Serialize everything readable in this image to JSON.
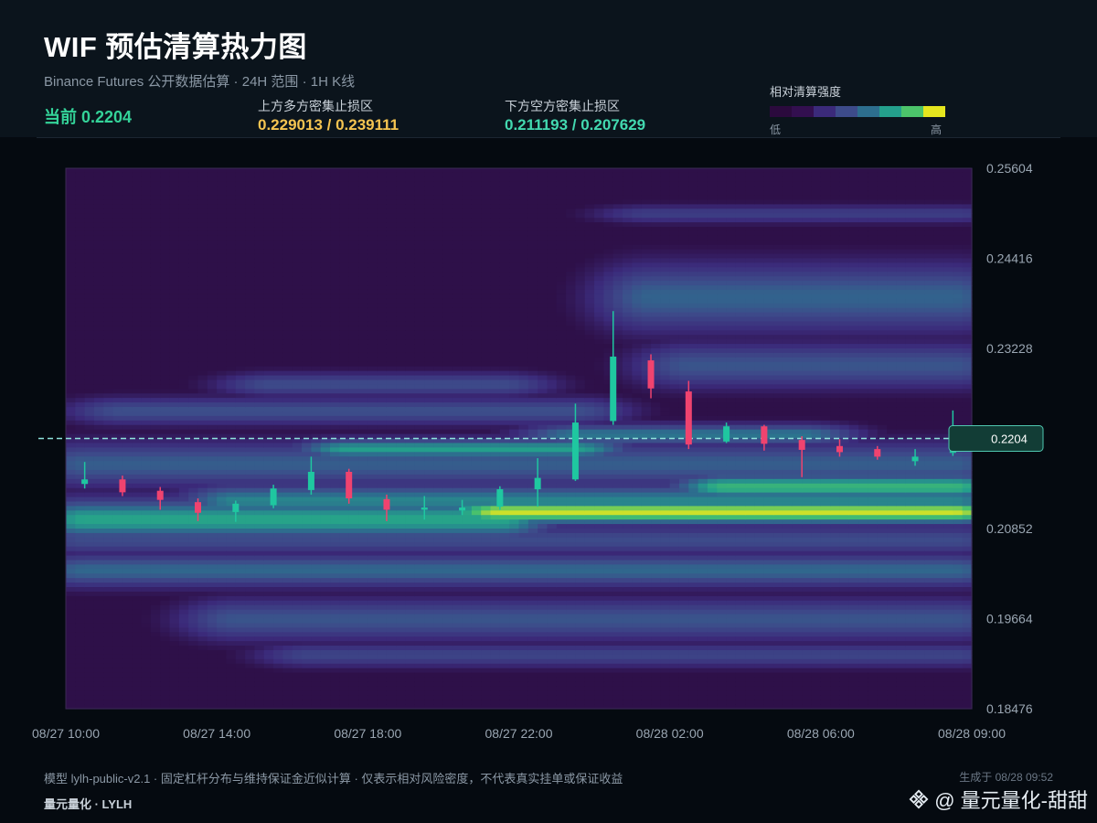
{
  "header": {
    "title": "WIF 预估清算热力图",
    "subtitle": "Binance Futures 公开数据估算 · 24H 范围 · 1H K线",
    "current_label": "当前 0.2204",
    "upper_zone_label": "上方多方密集止损区",
    "upper_zone_value": "0.229013 / 0.239111",
    "lower_zone_label": "下方空方密集止损区",
    "lower_zone_value": "0.211193 / 0.207629"
  },
  "legend": {
    "title": "相对清算强度",
    "low": "低",
    "high": "高",
    "colors": [
      "#2b0a3d",
      "#330f4f",
      "#3b2a7a",
      "#3d4b8a",
      "#2d6e8e",
      "#24a08c",
      "#4cc46a",
      "#e6e61e"
    ]
  },
  "footer": {
    "note": "模型 lylh-public-v2.1 · 固定杠杆分布与维持保证金近似计算 · 仅表示相对风险密度，不代表真实挂单或保证收益",
    "brand": "量元量化 · LYLH",
    "generated": "生成于 08/28 09:52",
    "watermark": "@ 量元量化-甜甜"
  },
  "chart_data": {
    "type": "heatmap",
    "title": "",
    "xlabel": "",
    "ylabel": "",
    "ylim": [
      0.18476,
      0.25604
    ],
    "y_ticks": [
      "0.25604",
      "0.24416",
      "0.23228",
      "0.20852",
      "0.19664",
      "0.18476"
    ],
    "x_ticks": [
      "08/27 10:00",
      "08/27 14:00",
      "08/27 18:00",
      "08/27 22:00",
      "08/28 02:00",
      "08/28 06:00",
      "08/28 09:00"
    ],
    "x_tick_hours": [
      0,
      4,
      8,
      12,
      16,
      20,
      23
    ],
    "current_price": 0.2204,
    "current_price_label": "0.2204",
    "colors": {
      "up": "#1fc7a0",
      "down": "#f0436f",
      "current_line": "#8fe3dc",
      "current_box": "#123d36"
    },
    "candles": [
      {
        "t": "08/27 10:00",
        "open": 0.2144,
        "high": 0.2173,
        "low": 0.2138,
        "close": 0.215
      },
      {
        "t": "08/27 11:00",
        "open": 0.215,
        "high": 0.2155,
        "low": 0.2128,
        "close": 0.2133
      },
      {
        "t": "08/27 12:00",
        "open": 0.2135,
        "high": 0.214,
        "low": 0.211,
        "close": 0.2123
      },
      {
        "t": "08/27 13:00",
        "open": 0.212,
        "high": 0.2125,
        "low": 0.2095,
        "close": 0.2106
      },
      {
        "t": "08/27 14:00",
        "open": 0.2107,
        "high": 0.2122,
        "low": 0.2094,
        "close": 0.2118
      },
      {
        "t": "08/27 15:00",
        "open": 0.2116,
        "high": 0.2143,
        "low": 0.2112,
        "close": 0.2138
      },
      {
        "t": "08/27 16:00",
        "open": 0.2136,
        "high": 0.218,
        "low": 0.213,
        "close": 0.216
      },
      {
        "t": "08/27 17:00",
        "open": 0.216,
        "high": 0.2164,
        "low": 0.2118,
        "close": 0.2125
      },
      {
        "t": "08/27 18:00",
        "open": 0.2124,
        "high": 0.213,
        "low": 0.2095,
        "close": 0.211
      },
      {
        "t": "08/27 19:00",
        "open": 0.211,
        "high": 0.2128,
        "low": 0.2097,
        "close": 0.2113
      },
      {
        "t": "08/27 20:00",
        "open": 0.2109,
        "high": 0.2123,
        "low": 0.2103,
        "close": 0.2113
      },
      {
        "t": "08/27 21:00",
        "open": 0.2114,
        "high": 0.2141,
        "low": 0.211,
        "close": 0.2137
      },
      {
        "t": "08/27 22:00",
        "open": 0.2137,
        "high": 0.2178,
        "low": 0.2114,
        "close": 0.2152
      },
      {
        "t": "08/27 23:00",
        "open": 0.215,
        "high": 0.225,
        "low": 0.2148,
        "close": 0.2225
      },
      {
        "t": "08/28 00:00",
        "open": 0.2227,
        "high": 0.2372,
        "low": 0.2222,
        "close": 0.2312
      },
      {
        "t": "08/28 01:00",
        "open": 0.2307,
        "high": 0.2315,
        "low": 0.2257,
        "close": 0.227
      },
      {
        "t": "08/28 02:00",
        "open": 0.2266,
        "high": 0.228,
        "low": 0.219,
        "close": 0.2196
      },
      {
        "t": "08/28 03:00",
        "open": 0.22,
        "high": 0.2225,
        "low": 0.2198,
        "close": 0.222
      },
      {
        "t": "08/28 04:00",
        "open": 0.222,
        "high": 0.2222,
        "low": 0.2188,
        "close": 0.2197
      },
      {
        "t": "08/28 05:00",
        "open": 0.2202,
        "high": 0.2207,
        "low": 0.2153,
        "close": 0.2189
      },
      {
        "t": "08/28 06:00",
        "open": 0.2194,
        "high": 0.2203,
        "low": 0.218,
        "close": 0.2186
      },
      {
        "t": "08/28 07:00",
        "open": 0.219,
        "high": 0.2194,
        "low": 0.2176,
        "close": 0.218
      },
      {
        "t": "08/28 08:00",
        "open": 0.2174,
        "high": 0.219,
        "low": 0.2168,
        "close": 0.218
      },
      {
        "t": "08/28 09:00",
        "open": 0.2185,
        "high": 0.2241,
        "low": 0.2181,
        "close": 0.2204
      }
    ],
    "heat_bands": [
      {
        "price": 0.2107,
        "intensity": 0.98,
        "width": 0.0016,
        "from_hour": 11,
        "to_hour": 23
      },
      {
        "price": 0.2097,
        "intensity": 0.72,
        "width": 0.0028,
        "from_hour": 0,
        "to_hour": 11
      },
      {
        "price": 0.2122,
        "intensity": 0.62,
        "width": 0.0022,
        "from_hour": 4,
        "to_hour": 23
      },
      {
        "price": 0.214,
        "intensity": 0.78,
        "width": 0.0018,
        "from_hour": 17,
        "to_hour": 23
      },
      {
        "price": 0.219,
        "intensity": 0.7,
        "width": 0.0014,
        "from_hour": 7,
        "to_hour": 13
      },
      {
        "price": 0.2209,
        "intensity": 0.58,
        "width": 0.0014,
        "from_hour": 13,
        "to_hour": 19
      },
      {
        "price": 0.217,
        "intensity": 0.48,
        "width": 0.003,
        "from_hour": 0,
        "to_hour": 23
      },
      {
        "price": 0.224,
        "intensity": 0.42,
        "width": 0.0018,
        "from_hour": 1,
        "to_hour": 13
      },
      {
        "price": 0.2275,
        "intensity": 0.4,
        "width": 0.0016,
        "from_hour": 5,
        "to_hour": 11
      },
      {
        "price": 0.239,
        "intensity": 0.5,
        "width": 0.0045,
        "from_hour": 15,
        "to_hour": 23
      },
      {
        "price": 0.23,
        "intensity": 0.44,
        "width": 0.003,
        "from_hour": 16,
        "to_hour": 23
      },
      {
        "price": 0.25,
        "intensity": 0.32,
        "width": 0.0012,
        "from_hour": 15,
        "to_hour": 23
      },
      {
        "price": 0.203,
        "intensity": 0.52,
        "width": 0.0022,
        "from_hour": 0,
        "to_hour": 23
      },
      {
        "price": 0.1965,
        "intensity": 0.44,
        "width": 0.0028,
        "from_hour": 4,
        "to_hour": 23
      },
      {
        "price": 0.1918,
        "intensity": 0.36,
        "width": 0.0016,
        "from_hour": 6,
        "to_hour": 23
      },
      {
        "price": 0.207,
        "intensity": 0.4,
        "width": 0.002,
        "from_hour": 0,
        "to_hour": 23
      }
    ]
  }
}
